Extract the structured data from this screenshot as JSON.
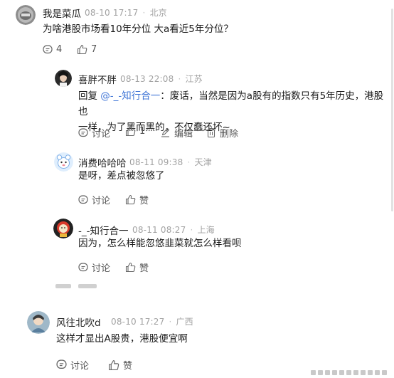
{
  "colors": {
    "mention": "#3e74d6",
    "meta": "#a2a2a2",
    "text": "#1a1a1a"
  },
  "comment1": {
    "author": "我是菜瓜",
    "date": "08-10 17:17",
    "location": "北京",
    "text": "为啥港股市场看10年分位 大a看近5年分位？",
    "reply_count": "4",
    "like_count": "7"
  },
  "reply1": {
    "author": "喜胖不胖",
    "date": "08-13 22:08",
    "location": "江苏",
    "prefix": "回复 ",
    "mention": "@-_-知行合一",
    "text_line1": "：废话，当然是因为a股有的指数只有5年历史，港股也",
    "text_line2": "一样，为了黑而黑的，不仅蠢还坏~",
    "discuss_label": "讨论",
    "like_count": "1",
    "edit_label": "编辑",
    "delete_label": "删除"
  },
  "reply2": {
    "author": "消费哈哈哈",
    "date": "08-11 09:38",
    "location": "天津",
    "text": "是呀，差点被忽悠了",
    "discuss_label": "讨论",
    "like_label": "赞"
  },
  "reply3": {
    "author": "-_-知行合一",
    "date": "08-11 08:27",
    "location": "上海",
    "text": "因为，怎么样能忽悠韭菜就怎么样看呗",
    "discuss_label": "讨论",
    "like_label": "赞"
  },
  "comment2": {
    "author": "风往北吹d",
    "date": "08-10 17:27",
    "location": "广西",
    "text": "这样才显出A股贵，港股便宜啊",
    "discuss_label": "讨论",
    "like_label": "赞"
  }
}
